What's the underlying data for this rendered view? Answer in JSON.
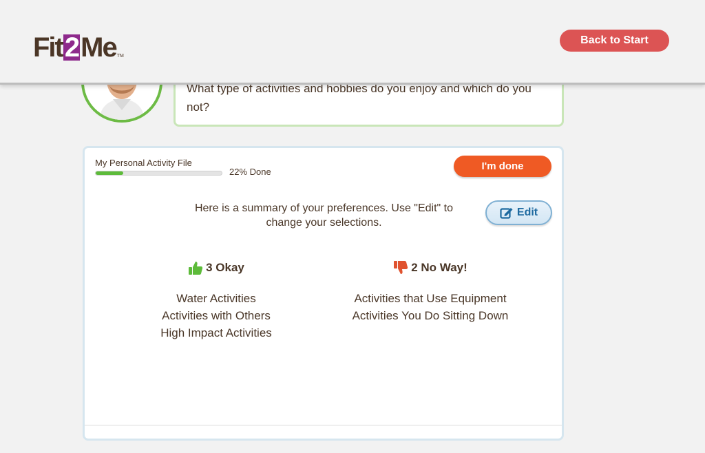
{
  "header": {
    "logo_left": "Fit",
    "logo_mid": "2",
    "logo_right": "Me",
    "logo_tm": "TM",
    "back_button": "Back to Start"
  },
  "coach": {
    "question": "What type of activities and hobbies do you enjoy and which do you not?"
  },
  "progress": {
    "label": "My Personal Activity File",
    "value_percent": 22,
    "text": "22% Done"
  },
  "actions": {
    "done_button": "I'm done",
    "edit_button": "Edit"
  },
  "summary_text": "Here is a summary of your preferences. Use \"Edit\" to change your selections.",
  "okay": {
    "heading": "3 Okay",
    "icon": "thumbs-up-icon",
    "color": "#5dbb3a",
    "items": [
      "Water Activities",
      "Activities with Others",
      "High Impact Activities"
    ]
  },
  "no_way": {
    "heading": "2 No Way!",
    "icon": "thumbs-down-icon",
    "color": "#e0532f",
    "items": [
      "Activities that Use Equipment",
      "Activities You Do Sitting Down"
    ]
  }
}
